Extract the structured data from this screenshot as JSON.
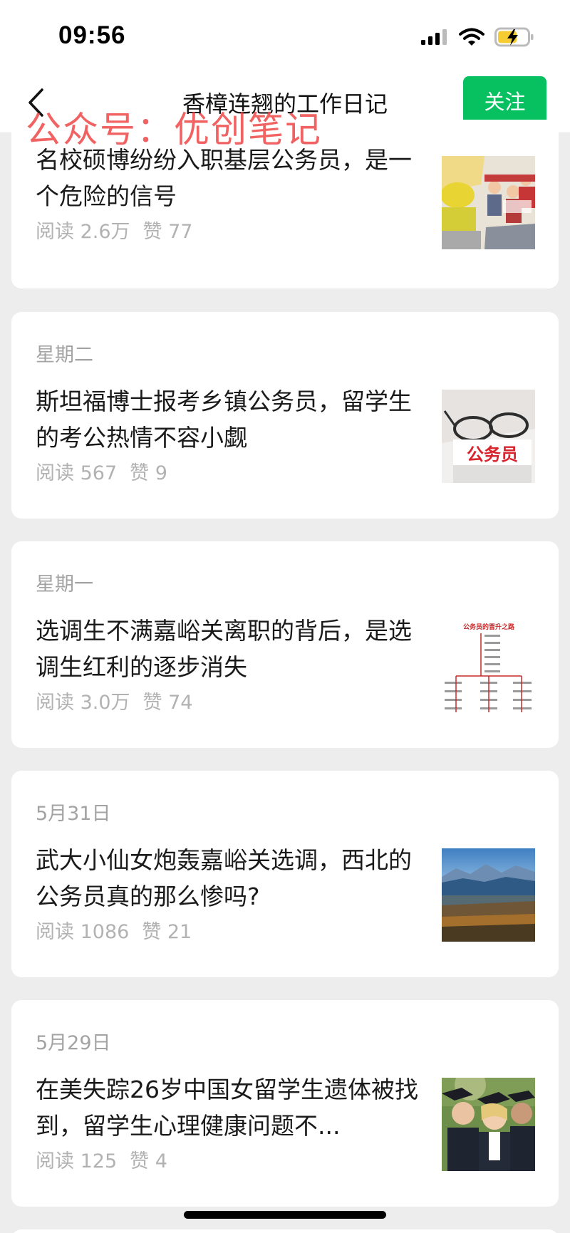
{
  "status": {
    "time": "09:56"
  },
  "nav": {
    "title": "香樟连翘的工作日记",
    "follow_label": "关注",
    "watermark": "公众号：优创笔记"
  },
  "articles": [
    {
      "date": "",
      "title": "名校硕博纷纷入职基层公务员，是一个危险的信号",
      "reads": "阅读 2.6万",
      "likes": "赞 77"
    },
    {
      "date": "星期二",
      "title": "斯坦福博士报考乡镇公务员，留学生的考公热情不容小觑",
      "reads": "阅读 567",
      "likes": "赞 9",
      "thumb_text": "公务员"
    },
    {
      "date": "星期一",
      "title": "选调生不满嘉峪关离职的背后，是选调生红利的逐步消失",
      "reads": "阅读 3.0万",
      "likes": "赞 74",
      "thumb_text": "公务员的晋升之路"
    },
    {
      "date": "5月31日",
      "title": "武大小仙女炮轰嘉峪关选调，西北的公务员真的那么惨吗?",
      "reads": "阅读 1086",
      "likes": "赞 21"
    },
    {
      "date": "5月29日",
      "title": "在美失踪26岁中国女留学生遗体被找到，留学生心理健康问题不...",
      "reads": "阅读 125",
      "likes": "赞 4"
    }
  ]
}
